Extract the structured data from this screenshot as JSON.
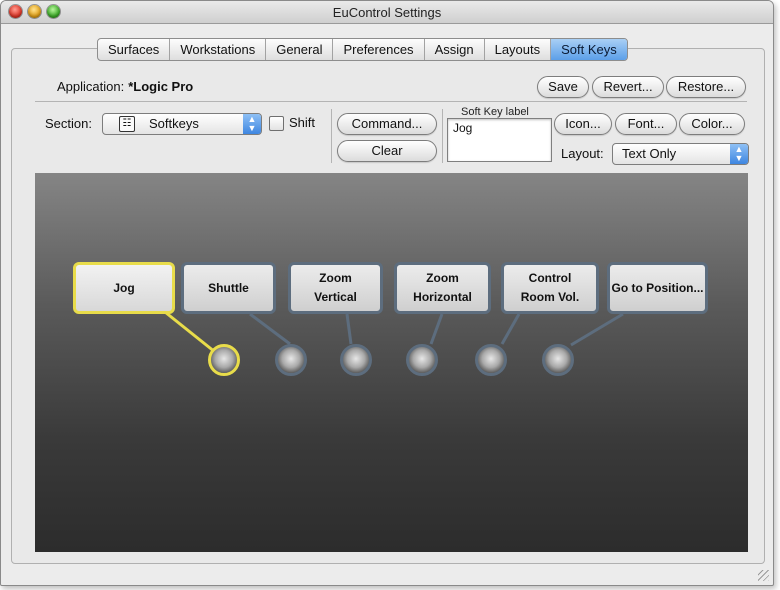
{
  "window": {
    "title": "EuControl Settings"
  },
  "tabs": [
    {
      "label": "Surfaces",
      "active": false
    },
    {
      "label": "Workstations",
      "active": false
    },
    {
      "label": "General",
      "active": false
    },
    {
      "label": "Preferences",
      "active": false
    },
    {
      "label": "Assign",
      "active": false
    },
    {
      "label": "Layouts",
      "active": false
    },
    {
      "label": "Soft Keys",
      "active": true
    }
  ],
  "application": {
    "label": "Application:",
    "value": "*Logic Pro"
  },
  "actions": {
    "save": "Save",
    "revert": "Revert...",
    "restore": "Restore..."
  },
  "section": {
    "label": "Section:",
    "value": "Softkeys",
    "shift_label": "Shift",
    "shift_checked": false
  },
  "command": {
    "command_label": "Command...",
    "clear_label": "Clear"
  },
  "soft_key_label": {
    "caption": "Soft Key label",
    "value": "Jog"
  },
  "style_buttons": {
    "icon": "Icon...",
    "font": "Font...",
    "color": "Color..."
  },
  "layout": {
    "label": "Layout:",
    "value": "Text Only"
  },
  "softkeys": [
    {
      "line1": "Jog",
      "line2": "",
      "selected": true
    },
    {
      "line1": "Shuttle",
      "line2": "",
      "selected": false
    },
    {
      "line1": "Zoom",
      "line2": "Vertical",
      "selected": false
    },
    {
      "line1": "Zoom",
      "line2": "Horizontal",
      "selected": false
    },
    {
      "line1": "Control",
      "line2": "Room Vol.",
      "selected": false
    },
    {
      "line1": "Go to Position...",
      "line2": "",
      "selected": false
    }
  ],
  "colors": {
    "selected_outline": "#e8dc4a",
    "key_outline": "#5d6d7e",
    "active_tab": "#5c9fe8"
  }
}
